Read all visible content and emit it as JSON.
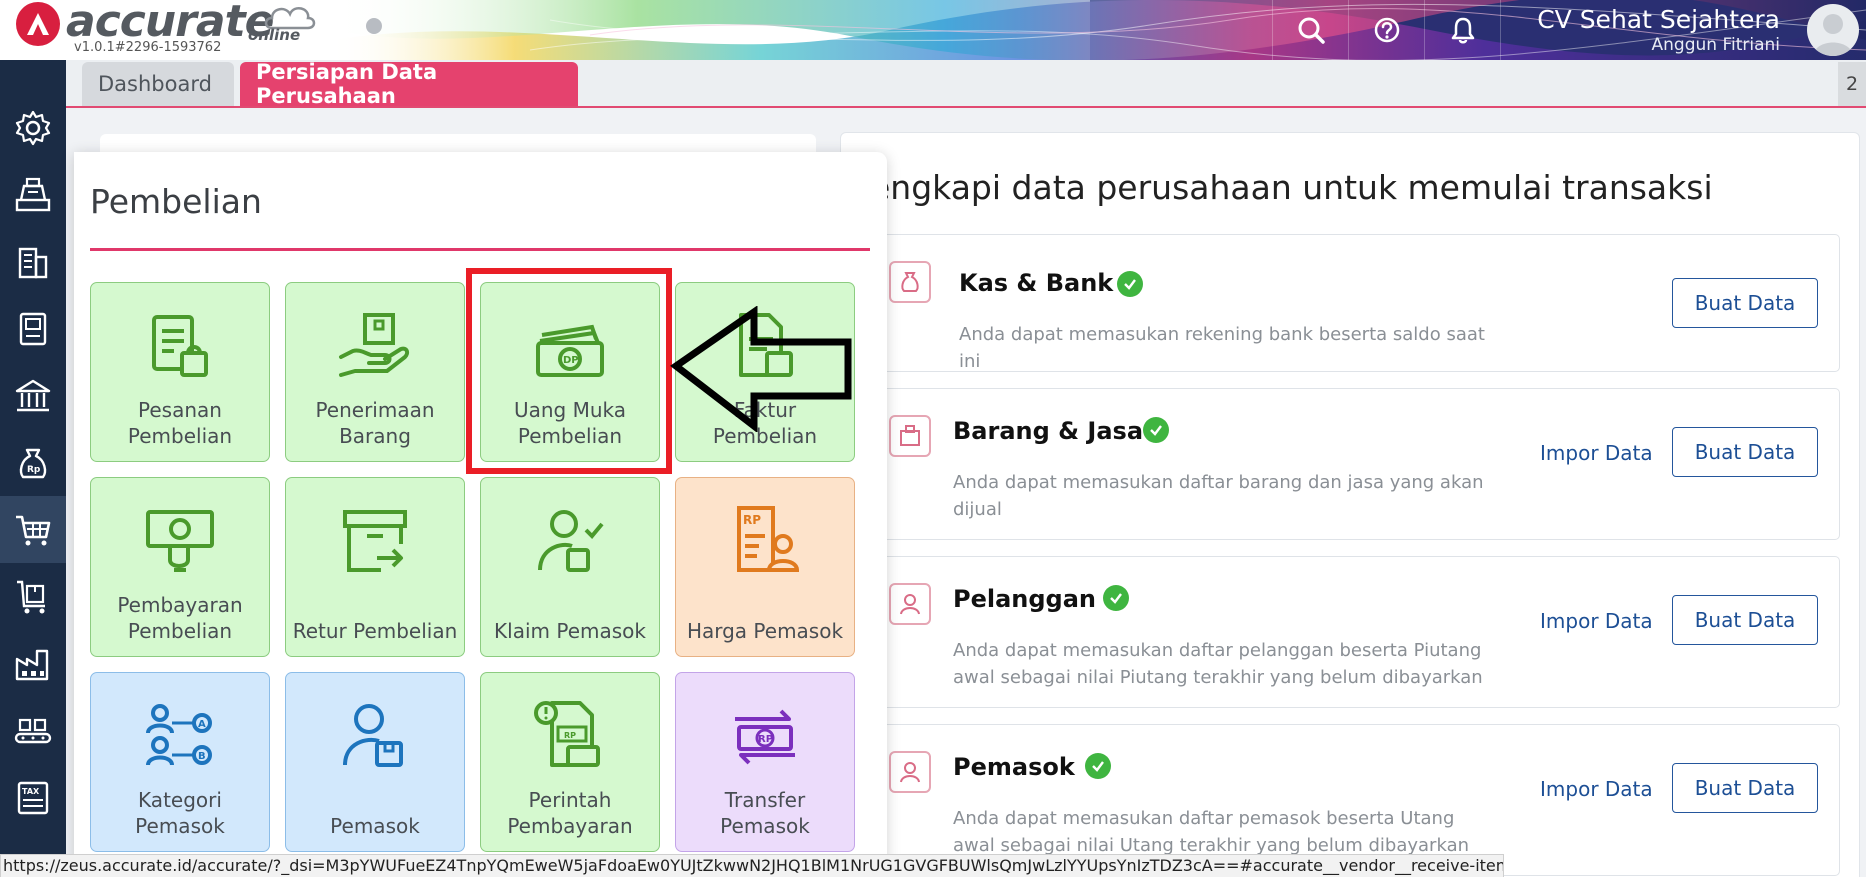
{
  "app": {
    "logo_text": "accurate",
    "logo_sub": "online",
    "version": "v1.0.1#2296-1593762"
  },
  "header": {
    "company_name": "CV Sehat Sejahtera",
    "user_name": "Anggun Fitriani",
    "icons": [
      "search-icon",
      "help-icon",
      "bell-icon",
      "avatar"
    ]
  },
  "sidebar": {
    "items": [
      {
        "icon": "gear-icon",
        "active": false
      },
      {
        "icon": "cash-register-icon",
        "active": false
      },
      {
        "icon": "building-icon",
        "active": false
      },
      {
        "icon": "ledger-icon",
        "active": false
      },
      {
        "icon": "bank-icon",
        "active": false
      },
      {
        "icon": "money-bag-icon",
        "active": false
      },
      {
        "icon": "cart-icon",
        "active": true
      },
      {
        "icon": "shopping-cart-box-icon",
        "active": false
      },
      {
        "icon": "factory-icon",
        "active": false
      },
      {
        "icon": "conveyor-icon",
        "active": false
      },
      {
        "icon": "tax-report-icon",
        "active": false
      }
    ]
  },
  "tabs": {
    "dashboard": "Dashboard",
    "persiapan": "Persiapan Data Perusahaan",
    "count": "2"
  },
  "main": {
    "title": "engkapi data perusahaan untuk memulai transaksi",
    "tasks": [
      {
        "title": "Kas & Bank",
        "desc": "Anda dapat memasukan rekening bank beserta saldo saat ini",
        "impor": "",
        "buat": "Buat Data"
      },
      {
        "title": "Barang & Jasa",
        "desc": "Anda dapat memasukan daftar barang dan jasa yang akan dijual",
        "impor": "Impor Data",
        "buat": "Buat Data"
      },
      {
        "title": "Pelanggan",
        "desc": "Anda dapat memasukan daftar pelanggan beserta Piutang awal sebagai nilai Piutang terakhir yang belum dibayarkan",
        "impor": "Impor Data",
        "buat": "Buat Data"
      },
      {
        "title": "Pemasok",
        "desc": "Anda dapat memasukan daftar pemasok beserta Utang awal sebagai nilai Utang terakhir yang belum dibayarkan",
        "impor": "Impor Data",
        "buat": "Buat Data"
      }
    ]
  },
  "popup": {
    "title": "Pembelian",
    "tiles": [
      {
        "label": "Pesanan Pembelian",
        "icon": "purchase-order-icon",
        "color": "green"
      },
      {
        "label": "Penerimaan Barang",
        "icon": "receive-item-icon",
        "color": "green"
      },
      {
        "label": "Uang Muka Pembelian",
        "icon": "down-payment-icon",
        "color": "green"
      },
      {
        "label": "Faktur Pembelian",
        "icon": "purchase-invoice-icon",
        "color": "green"
      },
      {
        "label": "Pembayaran Pembelian",
        "icon": "purchase-payment-icon",
        "color": "green"
      },
      {
        "label": "Retur Pembelian",
        "icon": "purchase-return-icon",
        "color": "green"
      },
      {
        "label": "Klaim Pemasok",
        "icon": "vendor-claim-icon",
        "color": "green"
      },
      {
        "label": "Harga Pemasok",
        "icon": "vendor-price-icon",
        "color": "orange"
      },
      {
        "label": "Kategori Pemasok",
        "icon": "vendor-category-icon",
        "color": "blue"
      },
      {
        "label": "Pemasok",
        "icon": "vendor-icon",
        "color": "blue"
      },
      {
        "label": "Perintah Pembayaran",
        "icon": "payment-order-icon",
        "color": "green"
      },
      {
        "label": "Transfer Pemasok",
        "icon": "vendor-transfer-icon",
        "color": "purple"
      }
    ]
  },
  "status_url": "https://zeus.accurate.id/accurate/?_dsi=M3pYWUFueEZ4TnpYQmEweW5jaFdoaEw0YUJtZkwwN2JHQ1BlM1NrUG1GVGFBUWlsQmJwLzlYYUpsYnIzTDZ3cA==#accurate__vendor__receive-item",
  "colors": {
    "accent": "#e5426e",
    "sidebar": "#1b2c45",
    "success": "#3fb540",
    "link": "#1d4f95",
    "highlight": "#ea1e26"
  }
}
